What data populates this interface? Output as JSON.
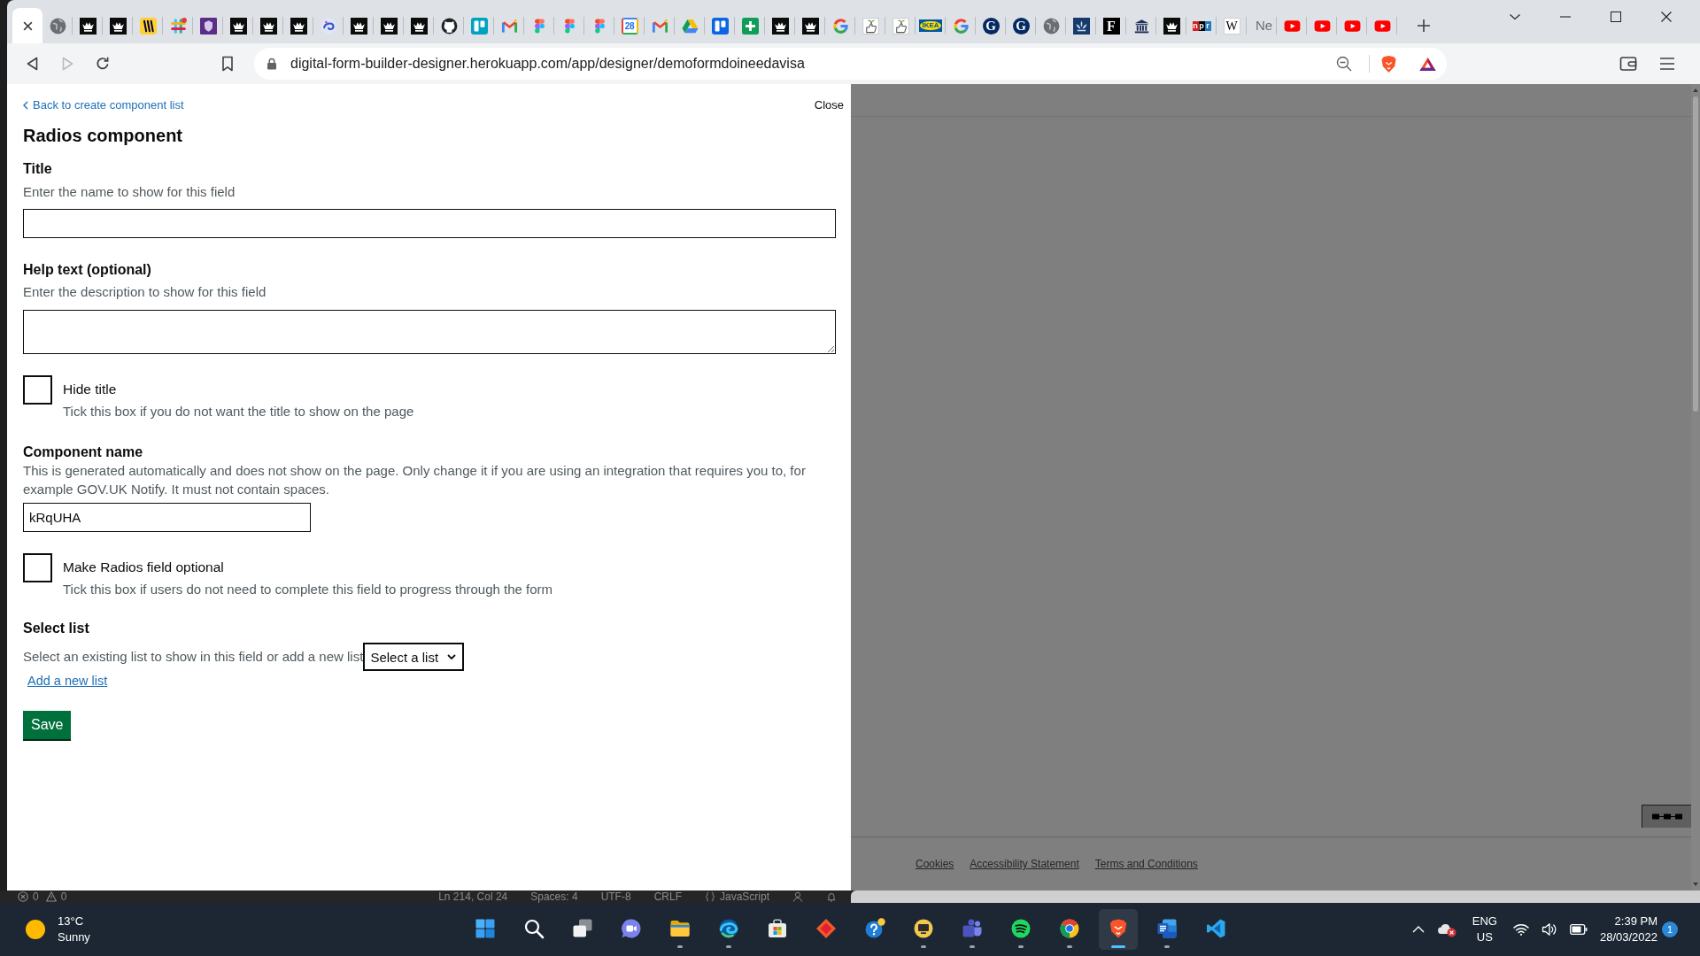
{
  "browser": {
    "tabs": [
      {
        "selected": true
      },
      {
        "kind": "globe",
        "selected": false
      },
      {
        "kind": "crown",
        "selected": false
      },
      {
        "kind": "crown",
        "selected": false
      },
      {
        "kind": "stripes",
        "selected": false
      },
      {
        "kind": "hash",
        "selected": false
      },
      {
        "kind": "crest",
        "selected": false
      },
      {
        "kind": "crown",
        "selected": false
      },
      {
        "kind": "crown",
        "selected": false
      },
      {
        "kind": "crown",
        "selected": false
      },
      {
        "kind": "swirl",
        "selected": false
      },
      {
        "kind": "crown",
        "selected": false
      },
      {
        "kind": "crown",
        "selected": false
      },
      {
        "kind": "crown",
        "selected": false
      },
      {
        "kind": "cat",
        "selected": false
      },
      {
        "kind": "board",
        "selected": false
      },
      {
        "kind": "envelope",
        "selected": false
      },
      {
        "kind": "shapes",
        "selected": false
      },
      {
        "kind": "shapes",
        "selected": false
      },
      {
        "kind": "shapes",
        "selected": false
      },
      {
        "kind": "calendar",
        "text": "28",
        "selected": false
      },
      {
        "kind": "envelope",
        "selected": false
      },
      {
        "kind": "triangle",
        "selected": false
      },
      {
        "kind": "columns",
        "selected": false
      },
      {
        "kind": "plus",
        "selected": false
      },
      {
        "kind": "crown",
        "selected": false
      },
      {
        "kind": "crown",
        "selected": false
      },
      {
        "kind": "ring",
        "selected": false
      },
      {
        "kind": "sprout",
        "selected": false
      },
      {
        "kind": "sprout",
        "selected": false
      },
      {
        "kind": "label",
        "text": "IKEA",
        "selected": false
      },
      {
        "kind": "ring",
        "selected": false
      },
      {
        "kind": "roundel",
        "text": "G",
        "selected": false
      },
      {
        "kind": "roundel",
        "text": "G",
        "selected": false
      },
      {
        "kind": "globe",
        "selected": false
      },
      {
        "kind": "emblem",
        "selected": false
      },
      {
        "kind": "masthead",
        "text": "F",
        "selected": false
      },
      {
        "kind": "building",
        "selected": false
      },
      {
        "kind": "crown",
        "selected": false
      },
      {
        "kind": "wordmark",
        "text": "npr",
        "selected": false
      },
      {
        "kind": "tile",
        "text": "W",
        "selected": false
      },
      {
        "kind": "title",
        "text": "Ne",
        "selected": false
      },
      {
        "kind": "play",
        "selected": false
      },
      {
        "kind": "play",
        "selected": false
      },
      {
        "kind": "play",
        "selected": false
      },
      {
        "kind": "play",
        "selected": false
      }
    ],
    "nav": [
      {
        "kind": "back",
        "disabled": false
      },
      {
        "kind": "forward",
        "disabled": true
      },
      {
        "kind": "reload",
        "disabled": false
      },
      {
        "kind": "bookmark",
        "disabled": false
      }
    ],
    "address": {
      "url": "digital-form-builder-designer.herokuapp.com/app/designer/demoformdoineedavisa"
    }
  },
  "panel": {
    "back_link": "Back to create component list",
    "close": "Close",
    "heading": "Radios component",
    "fields": [
      {
        "kind": "text",
        "label": "Title",
        "hint": "Enter the name to show for this field"
      },
      {
        "kind": "textarea",
        "label": "Help text (optional)",
        "hint": "Enter the description to show for this field"
      },
      {
        "kind": "checkbox",
        "label": "Hide title",
        "hint": "Tick this box if you do not want the title to show on the page",
        "checked": false
      },
      {
        "kind": "inline",
        "label": "Component name",
        "hint": "This is generated automatically and does not show on the page. Only change it if you are using an integration that requires you to, for example GOV.UK Notify. It must not contain spaces.",
        "value": "kRqUHA"
      },
      {
        "kind": "checkbox",
        "label": "Make Radios field optional",
        "hint": "Tick this box if users do not need to complete this field to progress through the form",
        "checked": false
      },
      {
        "kind": "select",
        "label": "Select list",
        "hint": "Select an existing list to show in this field or add a new list",
        "value": "Select a list",
        "link": "Add a new list"
      }
    ],
    "save": "Save"
  },
  "page_footer": {
    "links": [
      "Cookies",
      "Accessibility Statement",
      "Terms and Conditions"
    ]
  },
  "background_status_bar": {
    "problems": [
      {
        "kind": "error",
        "count": "0"
      },
      {
        "kind": "warning",
        "count": "0"
      }
    ],
    "items": [
      {
        "kind": "text",
        "label": "Ln 214, Col 24"
      },
      {
        "kind": "text",
        "label": "Spaces: 4"
      },
      {
        "kind": "text",
        "label": "UTF-8"
      },
      {
        "kind": "text",
        "label": "CRLF"
      },
      {
        "kind": "language",
        "label": "JavaScript"
      }
    ]
  },
  "taskbar": {
    "weather": {
      "temperature": "13°C",
      "condition": "Sunny"
    },
    "apps": [
      {
        "kind": "start",
        "running": false,
        "selected": false
      },
      {
        "kind": "search",
        "running": false,
        "selected": false
      },
      {
        "kind": "taskview",
        "running": false,
        "selected": false
      },
      {
        "kind": "chat",
        "running": false,
        "selected": false
      },
      {
        "kind": "explorer",
        "running": true,
        "selected": false
      },
      {
        "kind": "edge",
        "running": true,
        "selected": false
      },
      {
        "kind": "store",
        "running": false,
        "selected": false
      },
      {
        "kind": "diamond",
        "running": false,
        "selected": false
      },
      {
        "kind": "help",
        "running": false,
        "selected": false
      },
      {
        "kind": "screen",
        "running": true,
        "selected": false
      },
      {
        "kind": "teams",
        "running": true,
        "selected": false
      },
      {
        "kind": "spotify",
        "running": true,
        "selected": false
      },
      {
        "kind": "chrome",
        "running": true,
        "selected": false
      },
      {
        "kind": "brave",
        "running": true,
        "selected": true
      },
      {
        "kind": "word",
        "running": true,
        "selected": false
      },
      {
        "kind": "vscode",
        "running": false,
        "selected": false
      }
    ],
    "tray": {
      "language": "ENG",
      "region": "US",
      "time": "2:39 PM",
      "date": "28/03/2022",
      "notifications": "1"
    }
  }
}
